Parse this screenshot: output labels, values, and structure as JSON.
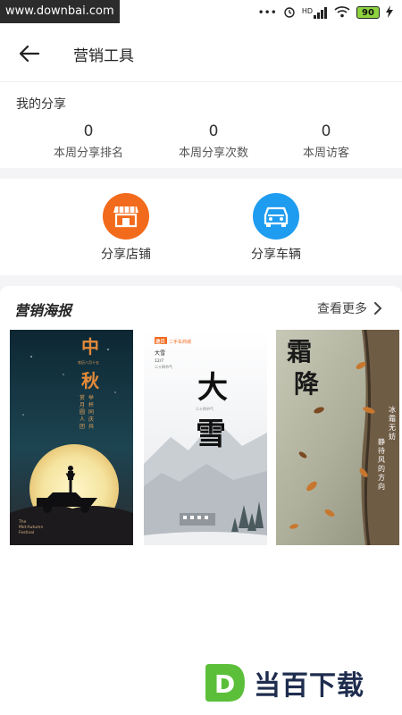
{
  "status_bar": {
    "watermark": "www.downbai.com",
    "signal_label": "HD",
    "battery": "90"
  },
  "header": {
    "title": "营销工具"
  },
  "my_share": {
    "title": "我的分享",
    "stats": [
      {
        "value": "0",
        "label": "本周分享排名"
      },
      {
        "value": "0",
        "label": "本周分享次数"
      },
      {
        "value": "0",
        "label": "本周访客"
      }
    ]
  },
  "actions": [
    {
      "label": "分享店铺",
      "icon": "store-icon",
      "color": "#f26a1b"
    },
    {
      "label": "分享车辆",
      "icon": "car-icon",
      "color": "#1e9cf0"
    }
  ],
  "posters": {
    "title": "营销海报",
    "more_label": "查看更多",
    "items": [
      {
        "name": "mid-autumn",
        "big_chars": [
          "中",
          "秋"
        ],
        "small_top": "农历八月十五",
        "vertical_text": "举杯同庆共赏月圆人团",
        "footer_lines": [
          "The",
          "Mid-Autumn",
          "Festival"
        ]
      },
      {
        "name": "heavy-snow",
        "badge": "途贝",
        "badge_label": "二手车商城",
        "date_title": "大雪",
        "date_num": "12/7",
        "date_sub": "二十四节气",
        "big_chars": [
          "大",
          "雪"
        ],
        "small_mid": "二十四节气"
      },
      {
        "name": "frost-descent",
        "big_chars": [
          "霜",
          "降"
        ],
        "vertical_a": "冰霜无妨",
        "vertical_b": "静待风的方向"
      }
    ]
  },
  "footer_watermark": {
    "text": "当百下载",
    "logo_letter": "D"
  },
  "colors": {
    "accent_orange": "#f26a1b",
    "accent_blue": "#1e9cf0"
  }
}
